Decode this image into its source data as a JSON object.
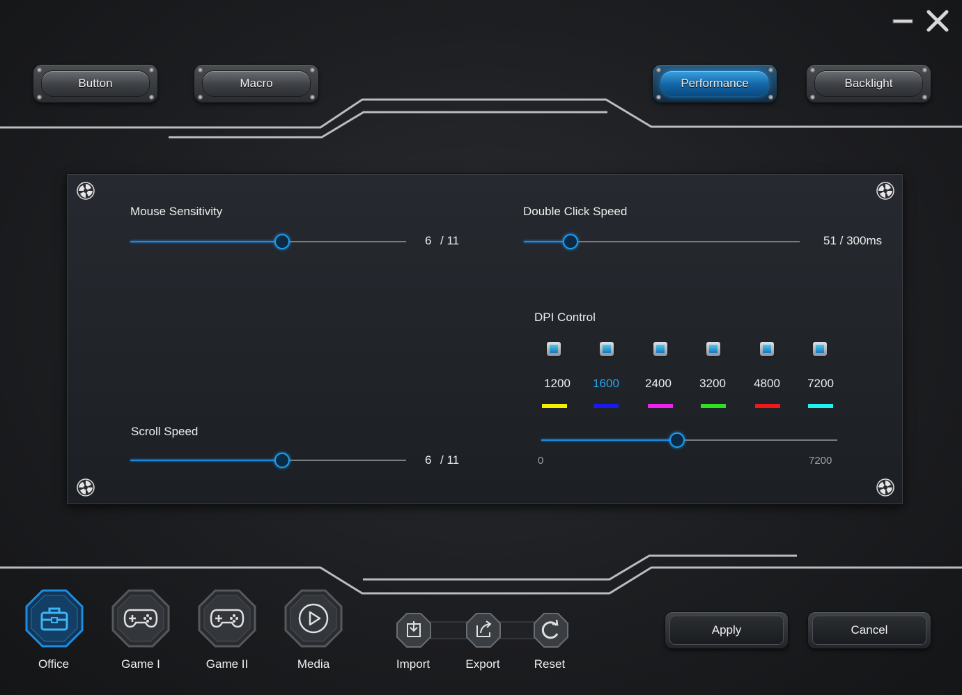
{
  "window": {
    "minimize_icon": "minimize-icon",
    "close_icon": "close-icon"
  },
  "tabs": [
    {
      "label": "Button",
      "active": false
    },
    {
      "label": "Macro",
      "active": false
    },
    {
      "label": "Performance",
      "active": true
    },
    {
      "label": "Backlight",
      "active": false
    }
  ],
  "performance": {
    "mouse_sensitivity": {
      "label": "Mouse Sensitivity",
      "value": "6",
      "max": "/ 11",
      "fraction": 0.55
    },
    "double_click_speed": {
      "label": "Double Click Speed",
      "value_text": "51 / 300ms",
      "fraction": 0.17
    },
    "scroll_speed": {
      "label": "Scroll Speed",
      "value": "6",
      "max": "/ 11",
      "fraction": 0.55
    },
    "dpi_control": {
      "label": "DPI Control",
      "levels": [
        {
          "value": "1200",
          "color": "#f4f000",
          "selected": false
        },
        {
          "value": "1600",
          "color": "#1a1af0",
          "selected": true
        },
        {
          "value": "2400",
          "color": "#f020f0",
          "selected": false
        },
        {
          "value": "3200",
          "color": "#30e020",
          "selected": false
        },
        {
          "value": "4800",
          "color": "#f01818",
          "selected": false
        },
        {
          "value": "7200",
          "color": "#20f0f0",
          "selected": false
        }
      ],
      "slider_min": "0",
      "slider_max": "7200",
      "slider_value": 3300
    }
  },
  "profiles": [
    {
      "label": "Office",
      "icon": "toolbox-icon",
      "active": true
    },
    {
      "label": "Game I",
      "icon": "gamepad-icon",
      "active": false
    },
    {
      "label": "Game II",
      "icon": "gamepad-icon",
      "active": false
    },
    {
      "label": "Media",
      "icon": "play-icon",
      "active": false
    }
  ],
  "tools": [
    {
      "label": "Import",
      "icon": "import-icon"
    },
    {
      "label": "Export",
      "icon": "export-icon"
    },
    {
      "label": "Reset",
      "icon": "reset-icon"
    }
  ],
  "actions": {
    "apply_label": "Apply",
    "cancel_label": "Cancel"
  },
  "colors": {
    "accent": "#1c9cf0",
    "selected_dpi_text": "#2aa6ee"
  }
}
